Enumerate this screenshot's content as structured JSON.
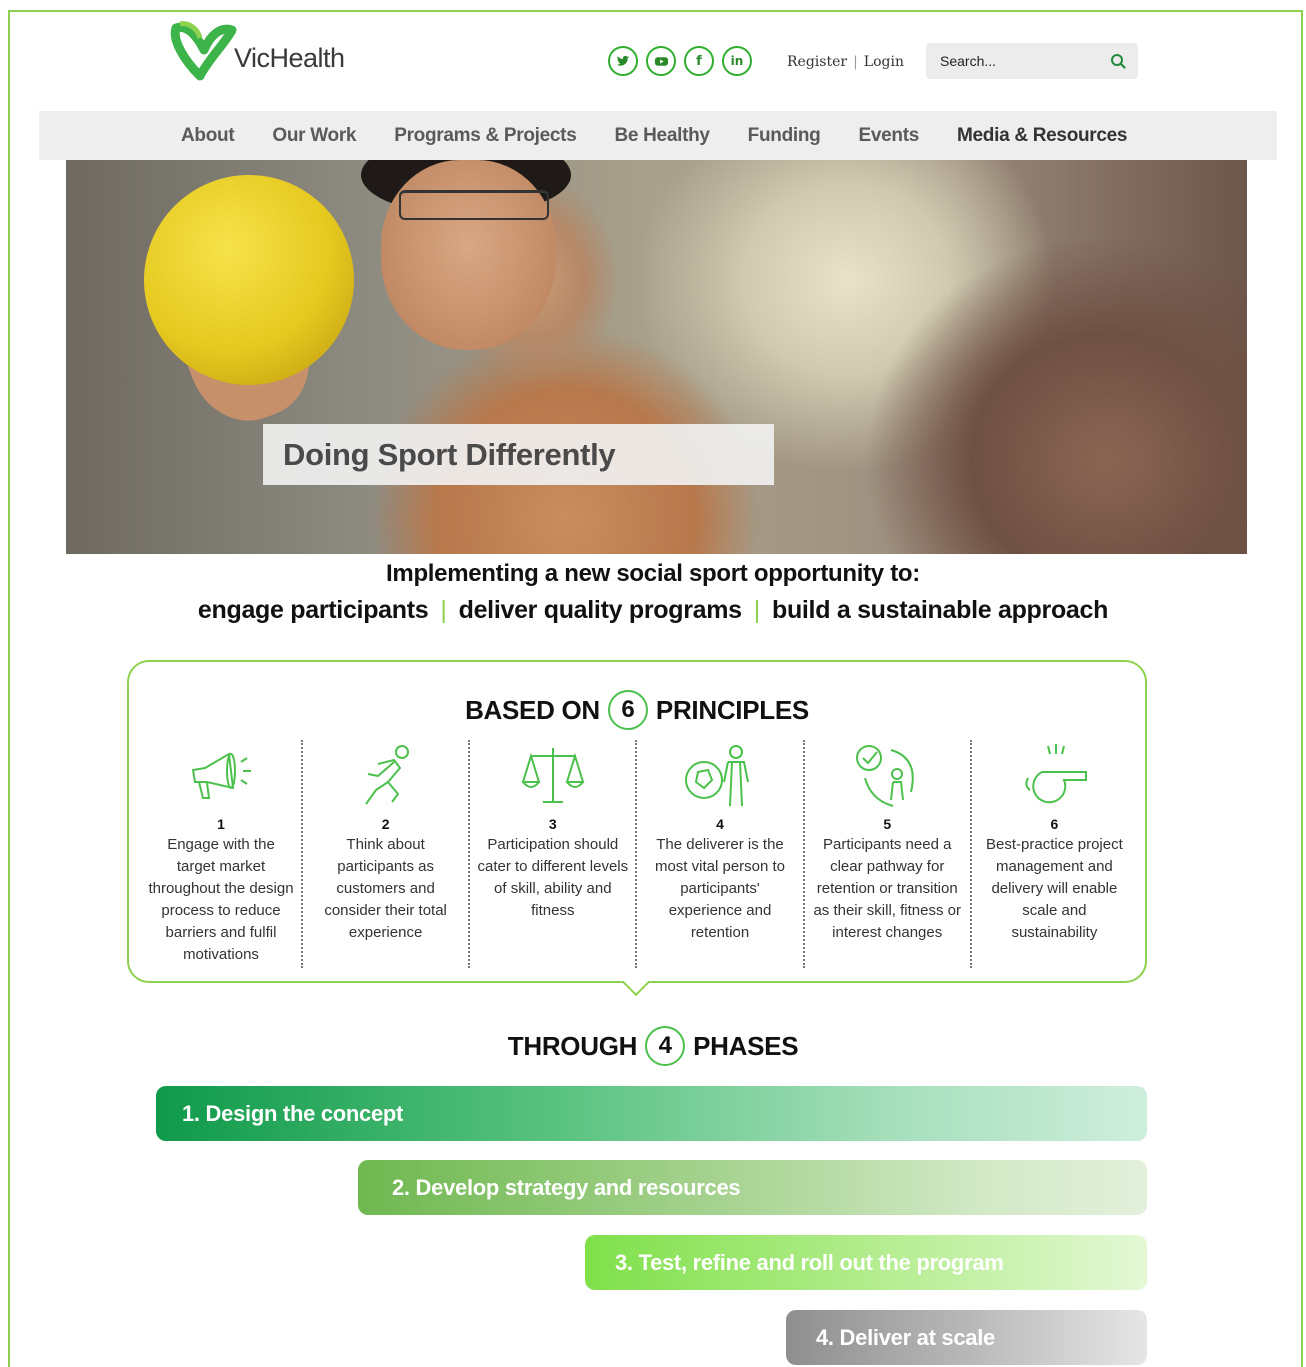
{
  "brand": {
    "name": "VicHealth",
    "accent": "#8ed14f",
    "green": "#2fae2f"
  },
  "header": {
    "socials": [
      {
        "icon": "twitter-icon",
        "glyph": "🐦"
      },
      {
        "icon": "youtube-icon",
        "glyph": "▶"
      },
      {
        "icon": "facebook-icon",
        "glyph": "f"
      },
      {
        "icon": "linkedin-icon",
        "glyph": "in"
      }
    ],
    "register_label": "Register",
    "separator": "|",
    "login_label": "Login",
    "search_placeholder": "Search..."
  },
  "nav": {
    "items": [
      "About",
      "Our Work",
      "Programs & Projects",
      "Be Healthy",
      "Funding",
      "Events",
      "Media & Resources"
    ],
    "active": "Media & Resources"
  },
  "hero": {
    "caption": "Doing Sport Differently"
  },
  "tagline": {
    "line1": "Implementing a new social sport opportunity to:",
    "parts": [
      "engage participants",
      "deliver quality programs",
      "build a sustainable approach"
    ],
    "separator": "|"
  },
  "principles": {
    "heading_before": "BASED ON",
    "count": "6",
    "heading_after": "PRINCIPLES",
    "items": [
      {
        "num": "1",
        "icon": "megaphone-icon",
        "text": "Engage with the target market throughout the design process to reduce barriers and fulfil motivations"
      },
      {
        "num": "2",
        "icon": "runner-icon",
        "text": "Think about participants as customers and consider their total experience"
      },
      {
        "num": "3",
        "icon": "scales-icon",
        "text": "Participation should cater to different levels of skill, ability and fitness"
      },
      {
        "num": "4",
        "icon": "ball-person-icon",
        "text": "The deliverer is the most vital person to participants' experience and retention"
      },
      {
        "num": "5",
        "icon": "pathway-icon",
        "text": "Participants need a clear pathway for retention or transition as their skill, fitness or interest changes"
      },
      {
        "num": "6",
        "icon": "whistle-icon",
        "text": "Best-practice project management and delivery will enable scale and sustainability"
      }
    ]
  },
  "phases": {
    "heading_before": "THROUGH",
    "count": "4",
    "heading_after": "PHASES",
    "items": [
      "1. Design the concept",
      "2. Develop strategy and resources",
      "3. Test, refine and roll out the program",
      "4. Deliver at scale"
    ]
  }
}
